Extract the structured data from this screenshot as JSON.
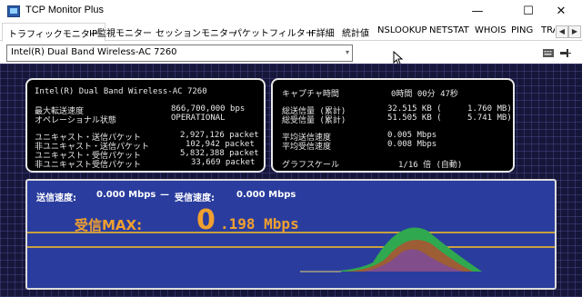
{
  "window": {
    "title": "TCP Monitor Plus",
    "minimize": "—",
    "maximize": "☐",
    "close": "✕"
  },
  "tabs": [
    {
      "label": "トラフィックモニター",
      "active": true
    },
    {
      "label": "IP監視モニター"
    },
    {
      "label": "セッションモニター"
    },
    {
      "label": "パケットフィルター"
    },
    {
      "label": "IF詳細"
    },
    {
      "label": "統計値"
    },
    {
      "label": "NSLOOKUP"
    },
    {
      "label": "NETSTAT"
    },
    {
      "label": "WHOIS"
    },
    {
      "label": "PING"
    },
    {
      "label": "TRA"
    }
  ],
  "tab_scroll": {
    "left": "◀",
    "right": "▶"
  },
  "toolbar": {
    "adapter_selected": "Intel(R) Dual Band Wireless-AC 7260",
    "caret": "▾"
  },
  "interface_box": {
    "name": "Intel(R) Dual Band Wireless-AC 7260",
    "max_speed_label": "最大転送速度",
    "max_speed_value": "866,700,000 bps",
    "op_state_label": "オペレーショナル状態",
    "op_state_value": "OPERATIONAL",
    "uc_send_label": "ユニキャスト・送信パケット",
    "uc_send_value": "2,927,126 packet",
    "nuc_send_label": "非ユニキャスト・送信パケット",
    "nuc_send_value": "102,942 packet",
    "uc_recv_label": "ユニキャスト・受信パケット",
    "uc_recv_value": "5,832,388 packet",
    "nuc_recv_label": "非ユニキャスト受信パケット",
    "nuc_recv_value": "33,669 packet"
  },
  "capture_box": {
    "capture_time_label": "キャプチャ時間",
    "capture_time_value": "0時間 00分 47秒",
    "total_send_label": "総送信量 (累計)",
    "total_send_kb": "32.515 KB (",
    "total_send_mb": "1.760 MB)",
    "total_recv_label": "総受信量 (累計)",
    "total_recv_kb": "51.505 KB (",
    "total_recv_mb": "5.741 MB)",
    "avg_send_label": "平均送信速度",
    "avg_send_value": "0.005 Mbps",
    "avg_recv_label": "平均受信速度",
    "avg_recv_value": "0.008 Mbps",
    "graph_scale_label": "グラフスケール",
    "graph_scale_value": "1/16 倍 (自動)"
  },
  "rate_panel": {
    "send_label": "送信速度:",
    "send_value": "0.000 Mbps",
    "separator": "—",
    "recv_label": "受信速度:",
    "recv_value": "0.000 Mbps",
    "max_label": "受信MAX:",
    "max_lead": "0",
    "max_rest": ".198 Mbps"
  },
  "colors": {
    "panel_bg": "#16163a",
    "rate_bg": "#2a3d9e",
    "accent_orange": "#f0a030",
    "graph_green": "#2fa84f",
    "graph_red": "#c03020"
  }
}
